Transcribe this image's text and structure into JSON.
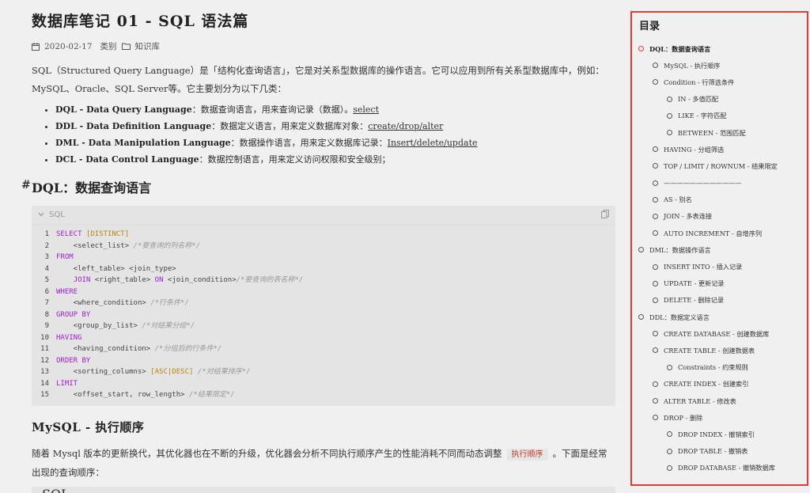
{
  "article": {
    "title": "数据库笔记 01 - SQL 语法篇",
    "date": "2020-02-17",
    "category_label": "类别",
    "category": "知识库",
    "intro": "SQL（Structured Query Language）是「结构化查询语言」，它是对关系型数据库的操作语言。它可以应用到所有关系型数据库中，例如：MySQL、Oracle、SQL Server等。它主要划分为以下几类：",
    "types": [
      {
        "name": "DQL - Data Query Language",
        "desc": "：数据查询语言，用来查询记录（数据）。",
        "cmd": "select"
      },
      {
        "name": "DDL - Data Definition Language",
        "desc": "：数据定义语言，用来定义数据库对象：",
        "cmd": "create/drop/alter"
      },
      {
        "name": "DML - Data Manipulation Language",
        "desc": "：数据操作语言，用来定义数据库记录：",
        "cmd": "Insert/delete/update"
      },
      {
        "name": "DCL - Data Control Language",
        "desc": "：数据控制语言，用来定义访问权限和安全级别；",
        "cmd": ""
      }
    ],
    "section1_title": "DQL：数据查询语言",
    "code_lang": "SQL",
    "section2_title": "MySQL - 执行顺序",
    "para2_before": "随着 Mysql 版本的更新换代，其优化器也在不断的升级，优化器会分析不同执行顺序产生的性能消耗不同而动态调整",
    "para2_tag": "执行顺序",
    "para2_after": "。下面是经常出现的查询顺序：",
    "code2_lang": "SQL"
  },
  "toc": {
    "title": "目录",
    "items": [
      {
        "label": "DQL：数据查询语言",
        "level": 0,
        "active": true
      },
      {
        "label": "MySQL - 执行顺序",
        "level": 1
      },
      {
        "label": "Condition - 行筛选条件",
        "level": 1
      },
      {
        "label": "IN - 多值匹配",
        "level": 2
      },
      {
        "label": "LIKE - 字符匹配",
        "level": 2
      },
      {
        "label": "BETWEEN - 范围匹配",
        "level": 2
      },
      {
        "label": "HAVING - 分组筛选",
        "level": 1
      },
      {
        "label": "TOP / LIMIT / ROWNUM - 结果限定",
        "level": 1
      },
      {
        "label": "————————————",
        "level": 1
      },
      {
        "label": "AS - 别名",
        "level": 1
      },
      {
        "label": "JOIN - 多表连接",
        "level": 1
      },
      {
        "label": "AUTO INCREMENT - 自增序列",
        "level": 1
      },
      {
        "label": "DML：数据操作语言",
        "level": 0
      },
      {
        "label": "INSERT INTO - 插入记录",
        "level": 1
      },
      {
        "label": "UPDATE - 更新记录",
        "level": 1
      },
      {
        "label": "DELETE - 删除记录",
        "level": 1
      },
      {
        "label": "DDL：数据定义语言",
        "level": 0
      },
      {
        "label": "CREATE DATABASE - 创建数据库",
        "level": 1
      },
      {
        "label": "CREATE TABLE - 创建数据表",
        "level": 1
      },
      {
        "label": "Constraints - 约束规则",
        "level": 2
      },
      {
        "label": "CREATE INDEX - 创建索引",
        "level": 1
      },
      {
        "label": "ALTER TABLE - 修改表",
        "level": 1
      },
      {
        "label": "DROP - 删除",
        "level": 1
      },
      {
        "label": "DROP INDEX - 撤销索引",
        "level": 2
      },
      {
        "label": "DROP TABLE - 撤销表",
        "level": 2
      },
      {
        "label": "DROP DATABASE - 撤销数据库",
        "level": 2
      }
    ]
  },
  "code": [
    [
      {
        "t": "SELECT ",
        "c": "k"
      },
      {
        "t": "[DISTINCT]",
        "c": "o"
      }
    ],
    [
      {
        "t": "    <select_list> ",
        "c": ""
      },
      {
        "t": "/*要查询的列名称*/",
        "c": "c"
      }
    ],
    [
      {
        "t": "FROM",
        "c": "k"
      }
    ],
    [
      {
        "t": "    <left_table> <join_type>",
        "c": ""
      }
    ],
    [
      {
        "t": "    ",
        "c": ""
      },
      {
        "t": "JOIN",
        "c": "k"
      },
      {
        "t": " <right_table> ",
        "c": ""
      },
      {
        "t": "ON",
        "c": "k"
      },
      {
        "t": " <join_condition>",
        "c": ""
      },
      {
        "t": "/*要查询的表名称*/",
        "c": "c"
      }
    ],
    [
      {
        "t": "WHERE",
        "c": "k"
      }
    ],
    [
      {
        "t": "    <where_condition> ",
        "c": ""
      },
      {
        "t": "/*行条件*/",
        "c": "c"
      }
    ],
    [
      {
        "t": "GROUP BY",
        "c": "k"
      }
    ],
    [
      {
        "t": "    <group_by_list> ",
        "c": ""
      },
      {
        "t": "/*对结果分组*/",
        "c": "c"
      }
    ],
    [
      {
        "t": "HAVING",
        "c": "k"
      }
    ],
    [
      {
        "t": "    <having_condition> ",
        "c": ""
      },
      {
        "t": "/*分组后的行条件*/",
        "c": "c"
      }
    ],
    [
      {
        "t": "ORDER BY",
        "c": "k"
      }
    ],
    [
      {
        "t": "    <sorting_columns> ",
        "c": ""
      },
      {
        "t": "[ASC|DESC]",
        "c": "o"
      },
      {
        "t": " ",
        "c": ""
      },
      {
        "t": "/*对结果排序*/",
        "c": "c"
      }
    ],
    [
      {
        "t": "LIMIT",
        "c": "k"
      }
    ],
    [
      {
        "t": "    <offset_start, row_length> ",
        "c": ""
      },
      {
        "t": "/*结果限定*/",
        "c": "c"
      }
    ]
  ]
}
